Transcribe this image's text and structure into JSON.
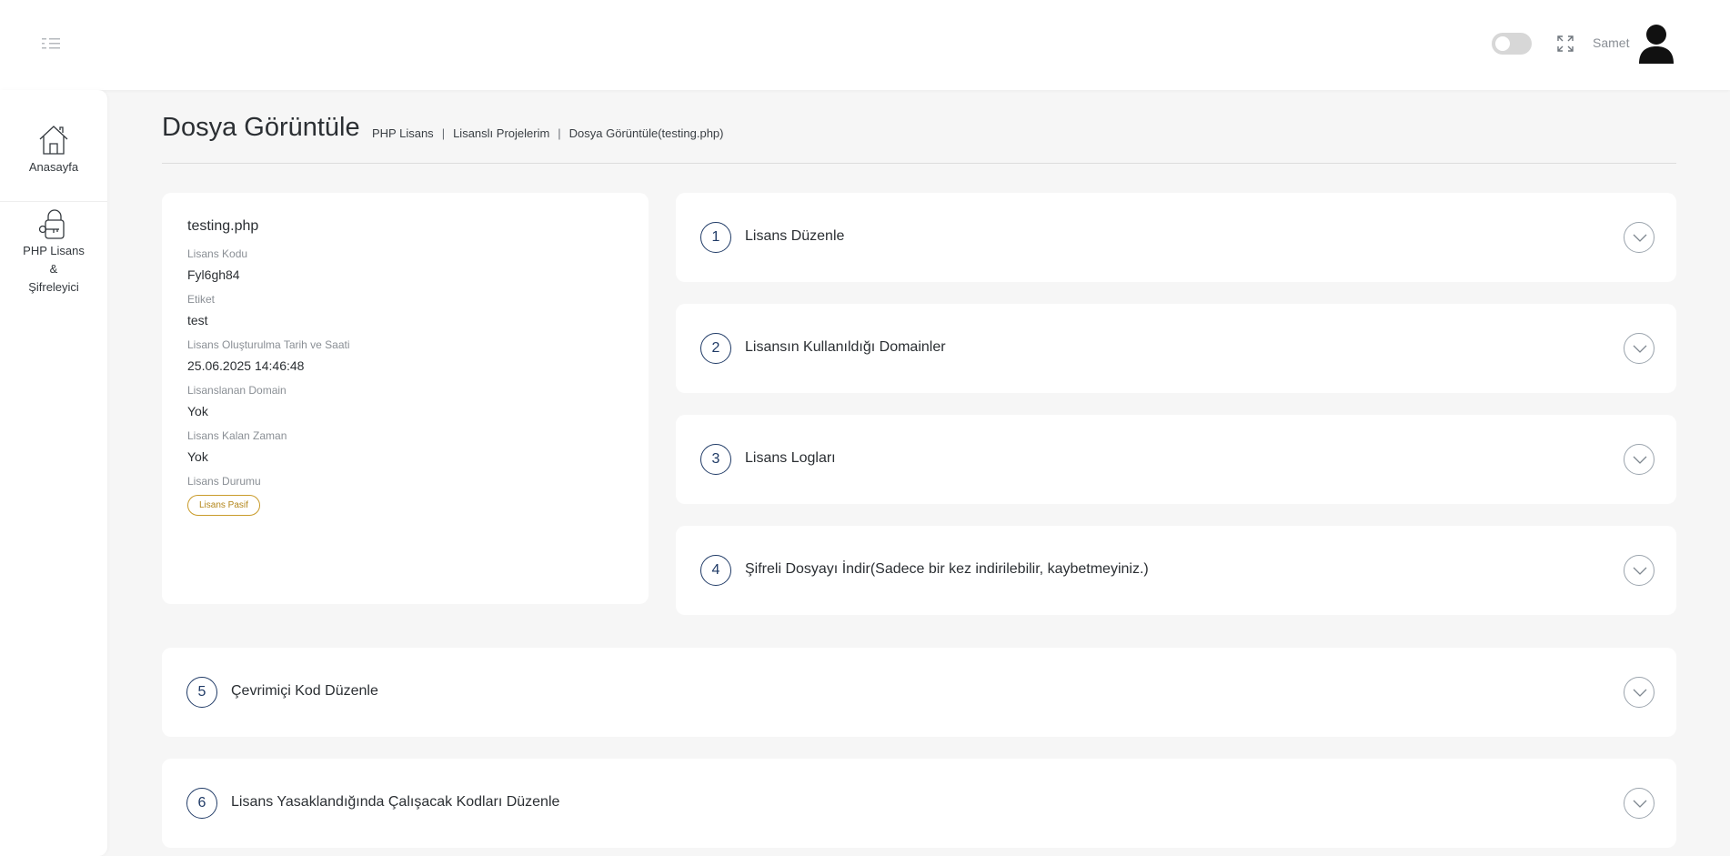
{
  "header": {
    "user_name": "Samet",
    "icons": {
      "menu": "menu-toggle-icon",
      "theme": "theme-toggle",
      "fullscreen": "fullscreen-icon",
      "avatar": "user-avatar-icon"
    }
  },
  "sidebar": {
    "items": [
      {
        "label": "Anasayfa",
        "icon": "home-icon"
      },
      {
        "label_line1": "PHP Lisans",
        "label_line2": "&",
        "label_line3": "Şifreleyici",
        "icon": "lock-key-icon"
      }
    ]
  },
  "page": {
    "title": "Dosya Görüntüle",
    "breadcrumb": [
      "PHP Lisans",
      "Lisanslı Projelerim",
      "Dosya Görüntüle(testing.php)"
    ],
    "breadcrumb_sep": "|"
  },
  "info": {
    "file_name": "testing.php",
    "fields": [
      {
        "label": "Lisans Kodu",
        "value": "Fyl6gh84"
      },
      {
        "label": "Etiket",
        "value": "test"
      },
      {
        "label": "Lisans Oluşturulma Tarih ve Saati",
        "value": "25.06.2025 14:46:48"
      },
      {
        "label": "Lisanslanan Domain",
        "value": "Yok"
      },
      {
        "label": "Lisans Kalan Zaman",
        "value": "Yok"
      }
    ],
    "status_label": "Lisans Durumu",
    "status_badge": "Lisans Pasif",
    "status_color": "#c99b2a"
  },
  "accordions": [
    {
      "num": "1",
      "title": "Lisans Düzenle"
    },
    {
      "num": "2",
      "title": "Lisansın Kullanıldığı Domainler"
    },
    {
      "num": "3",
      "title": "Lisans Logları"
    },
    {
      "num": "4",
      "title": "Şifreli Dosyayı İndir(Sadece bir kez indirilebilir, kaybetmeyiniz.)"
    },
    {
      "num": "5",
      "title": "Çevrimiçi Kod Düzenle"
    },
    {
      "num": "6",
      "title": "Lisans Yasaklandığında Çalışacak Kodları Düzenle"
    }
  ],
  "colors": {
    "accent": "#1f3a66",
    "background": "#f6f6f6",
    "card": "#ffffff"
  }
}
